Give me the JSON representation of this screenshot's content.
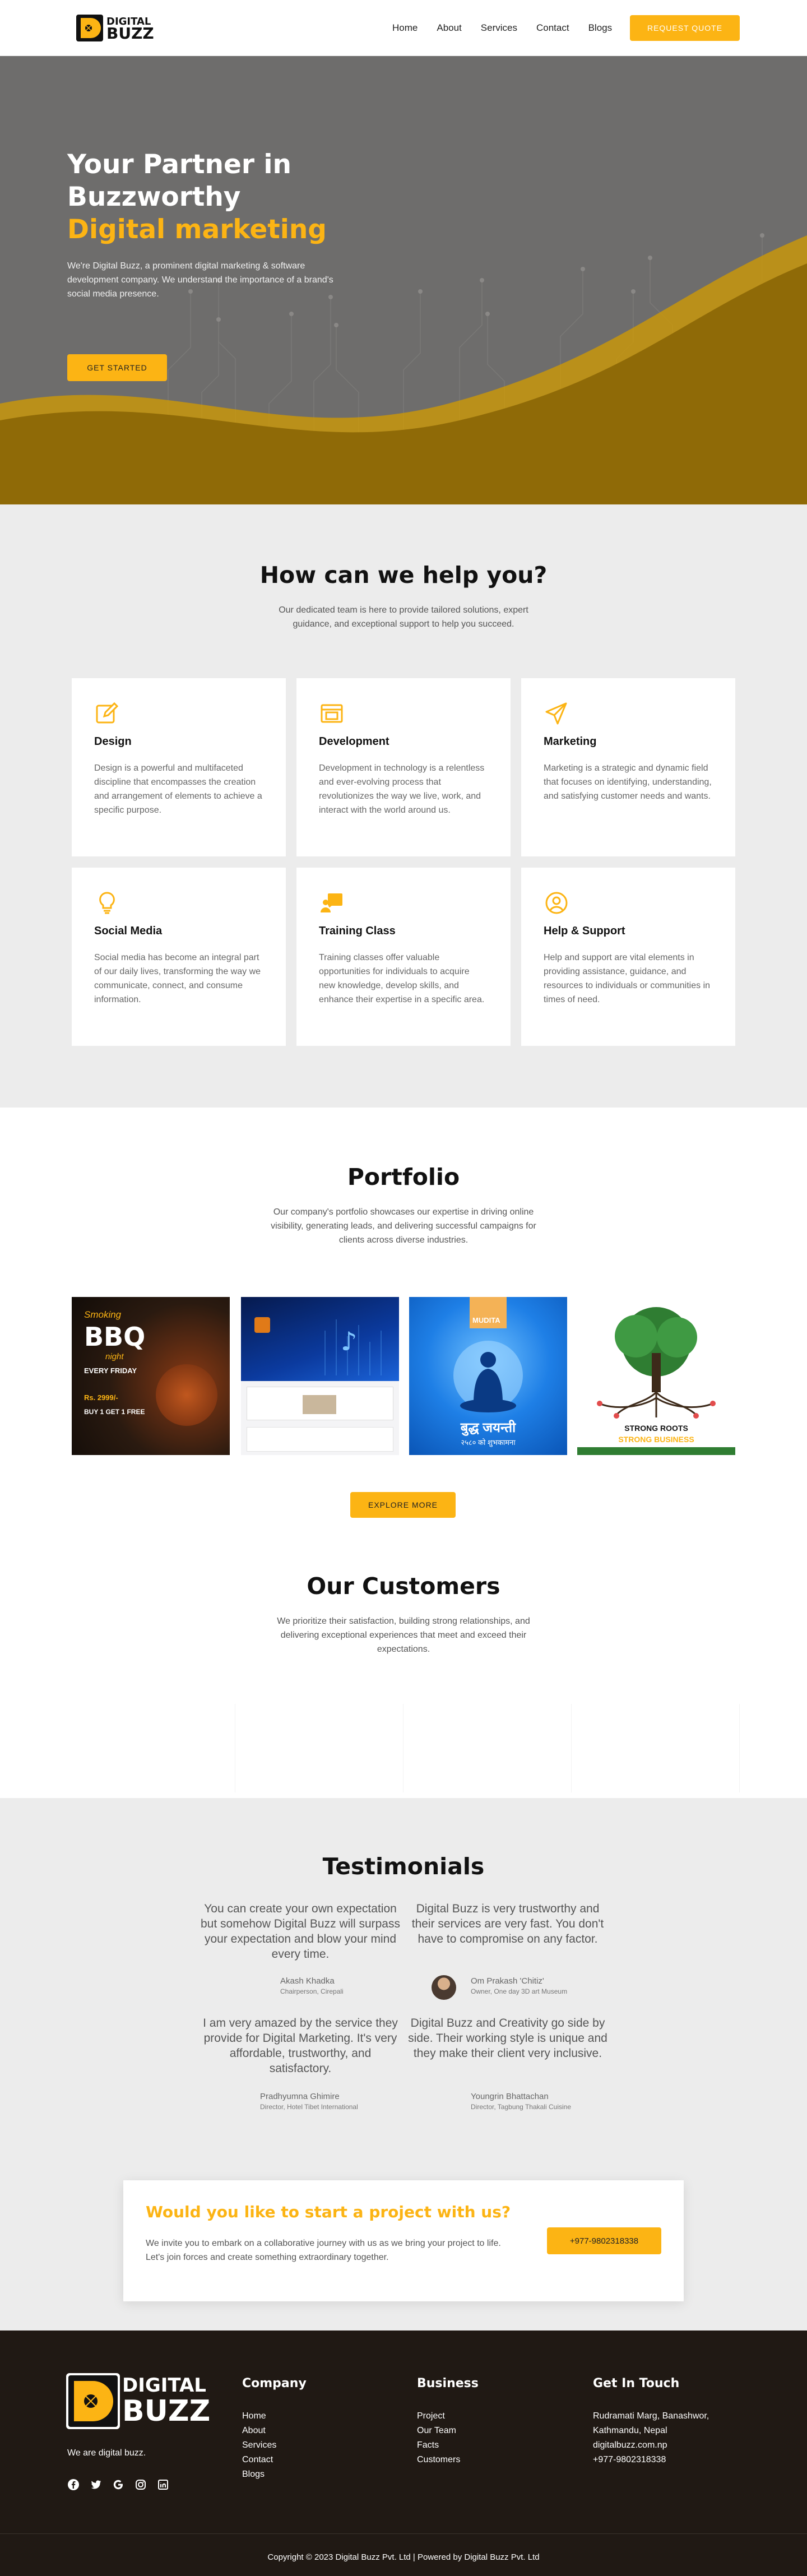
{
  "brand": {
    "name_line1": "DIGITAL",
    "name_line2": "BUZZ",
    "accent": "#fcb414"
  },
  "nav": {
    "items": [
      "Home",
      "About",
      "Services",
      "Contact",
      "Blogs"
    ],
    "quote_button": "REQUEST QUOTE"
  },
  "hero": {
    "title_line1": "Your Partner in",
    "title_line2": "Buzzworthy",
    "title_highlight": "Digital marketing",
    "description": "We're Digital Buzz, a prominent digital marketing & software development company. We understand the importance of a brand's social media presence.",
    "cta": "GET STARTED"
  },
  "help": {
    "title": "How can we help you?",
    "subtitle": "Our dedicated team is here to provide tailored solutions, expert guidance, and exceptional support to help you succeed.",
    "cards": [
      {
        "icon": "edit-icon",
        "title": "Design",
        "text": "Design is a powerful and multifaceted discipline that encompasses the creation and arrangement of elements to achieve a specific purpose."
      },
      {
        "icon": "code-icon",
        "title": "Development",
        "text": "Development in technology is a relentless and ever-evolving process that revolutionizes the way we live, work, and interact with the world around us."
      },
      {
        "icon": "paper-plane-icon",
        "title": "Marketing",
        "text": "Marketing is a strategic and dynamic field that focuses on identifying, understanding, and satisfying customer needs and wants."
      },
      {
        "icon": "lightbulb-icon",
        "title": "Social Media",
        "text": "Social media has become an integral part of our daily lives, transforming the way we communicate, connect, and consume information."
      },
      {
        "icon": "presentation-icon",
        "title": "Training Class",
        "text": "Training classes offer valuable opportunities for individuals to acquire new knowledge, develop skills, and enhance their expertise in a specific area."
      },
      {
        "icon": "user-circle-icon",
        "title": "Help & Support",
        "text": "Help and support are vital elements in providing assistance, guidance, and resources to individuals or communities in times of need."
      }
    ]
  },
  "portfolio": {
    "title": "Portfolio",
    "subtitle": "Our company's portfolio showcases our expertise in driving online visibility, generating leads, and delivering successful campaigns for clients across diverse industries.",
    "items": [
      {
        "image": "bbq-poster",
        "line1": "Smoking",
        "line2": "BBQ",
        "line3": "night",
        "line4": "EVERY FRIDAY",
        "line5": "Rs. 2999/-",
        "line6": "BUY 1 GET 1 FREE"
      },
      {
        "image": "music-website-mockup"
      },
      {
        "image": "buddha-jayanti-poster",
        "brand": "MUDITA",
        "text": "बुद्ध जयन्ती",
        "sub": "२५८० को शुभकामना"
      },
      {
        "image": "tree-poster",
        "line1": "STRONG ROOTS",
        "line2": "STRONG BUSINESS"
      }
    ],
    "cta": "EXPLORE MORE"
  },
  "customers": {
    "title": "Our Customers",
    "subtitle": "We prioritize their satisfaction, building strong relationships, and delivering exceptional experiences that meet and exceed their expectations."
  },
  "testimonials": {
    "title": "Testimonials",
    "items": [
      {
        "quote": "You can create your own expectation but somehow Digital Buzz will surpass your expectation and blow your mind every time.",
        "name": "Akash Khadka",
        "role": "Chairperson, Cirepali"
      },
      {
        "quote": "Digital Buzz is very trustworthy and their services are very fast. You don't have to compromise on any factor.",
        "name": "Om Prakash 'Chitiz'",
        "role": "Owner, One day 3D art Museum"
      },
      {
        "quote": "I am very amazed by the service they provide for Digital Marketing. It's very affordable, trustworthy, and satisfactory.",
        "name": "Pradhyumna Ghimire",
        "role": "Director, Hotel Tibet International"
      },
      {
        "quote": "Digital Buzz and Creativity go side by side. Their working style is unique and they make their client very inclusive.",
        "name": "Youngrin Bhattachan",
        "role": "Director, Tagbung Thakali Cuisine"
      }
    ]
  },
  "cta_section": {
    "title": "Would you like to start a project with us?",
    "text": "We invite you to embark on a collaborative journey with us as we bring your project to life. Let's join forces and create something extraordinary together.",
    "phone_button": "+977-9802318338"
  },
  "footer": {
    "tagline": "We are digital buzz.",
    "company": {
      "title": "Company",
      "links": [
        "Home",
        "About",
        "Services",
        "Contact",
        "Blogs"
      ]
    },
    "business": {
      "title": "Business",
      "links": [
        "Project",
        "Our Team",
        "Facts",
        "Customers"
      ]
    },
    "contact": {
      "title": "Get In Touch",
      "lines": [
        "Rudramati Marg, Banashwor,",
        "Kathmandu, Nepal",
        "digitalbuzz.com.np",
        "+977-9802318338"
      ]
    },
    "social_icons": [
      "facebook-icon",
      "twitter-icon",
      "google-icon",
      "instagram-icon",
      "linkedin-icon"
    ],
    "copyright": "Copyright © 2023 Digital Buzz Pvt. Ltd | Powered by Digital Buzz Pvt. Ltd"
  }
}
